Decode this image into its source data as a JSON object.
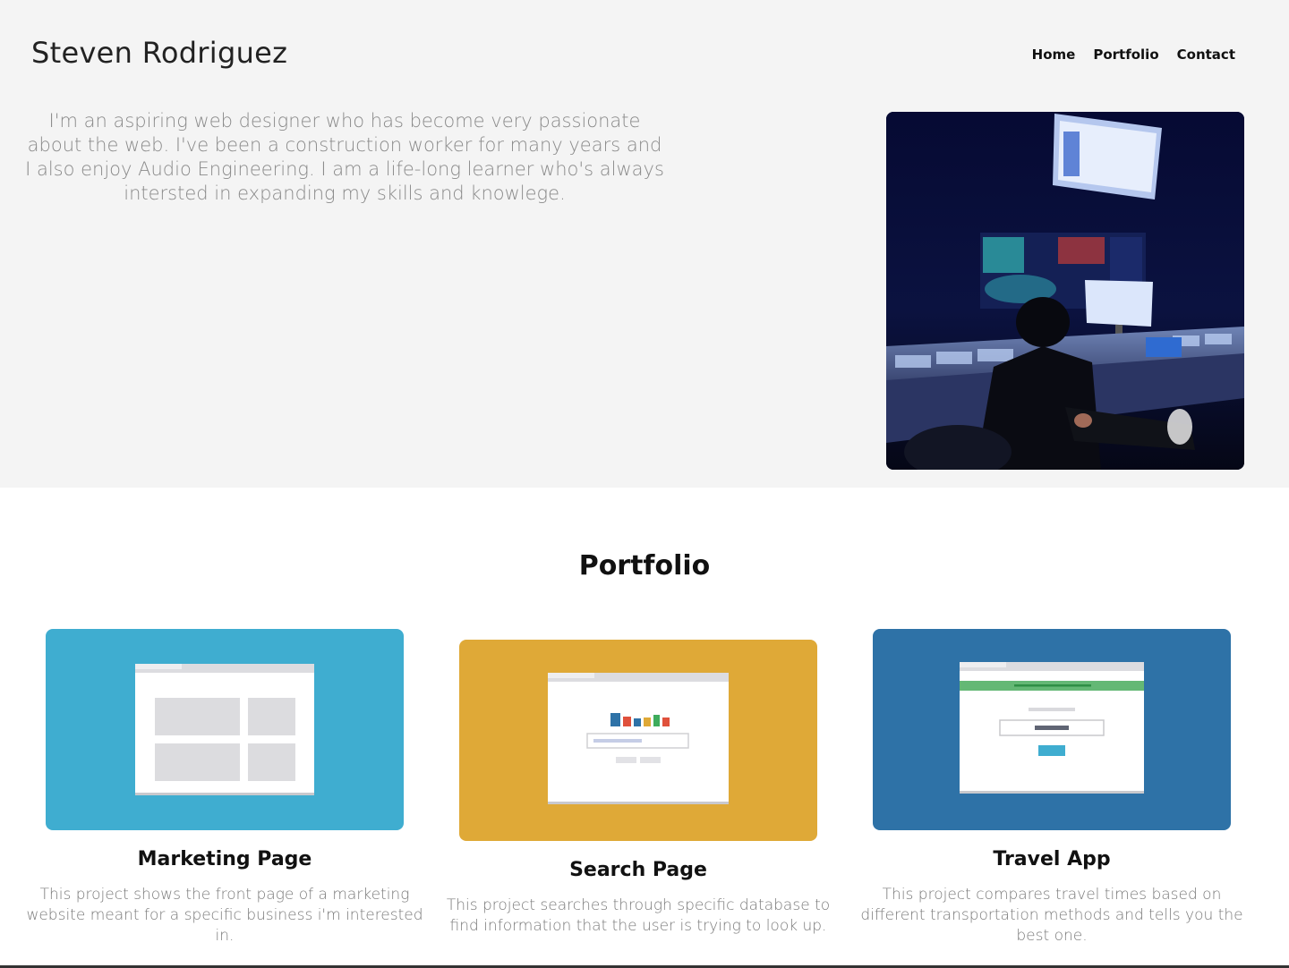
{
  "header": {
    "site_title": "Steven Rodriguez",
    "nav": [
      "Home",
      "Portfolio",
      "Contact"
    ]
  },
  "intro": {
    "text": "I'm an aspiring web designer who has become very passionate about the web. I've been a construction worker for many years and I also enjoy Audio Engineering. I am a life-long learner who's always intersted in expanding my skills and knowlege."
  },
  "portfolio": {
    "heading": "Portfolio",
    "cards": [
      {
        "title": "Marketing Page",
        "description": "This project shows the front page of a marketing website meant for a specific business i'm interested in.",
        "color": "#3fadd0"
      },
      {
        "title": "Search Page",
        "description": "This project searches through specific database to find information that the user is trying to look up.",
        "color": "#dfa937"
      },
      {
        "title": "Travel App",
        "description": "This project compares travel times based on different transportation methods and tells you the best one.",
        "color": "#2e72a7"
      }
    ]
  },
  "colors": {
    "top_background": "#f4f4f4",
    "bottom_background": "#ffffff"
  }
}
